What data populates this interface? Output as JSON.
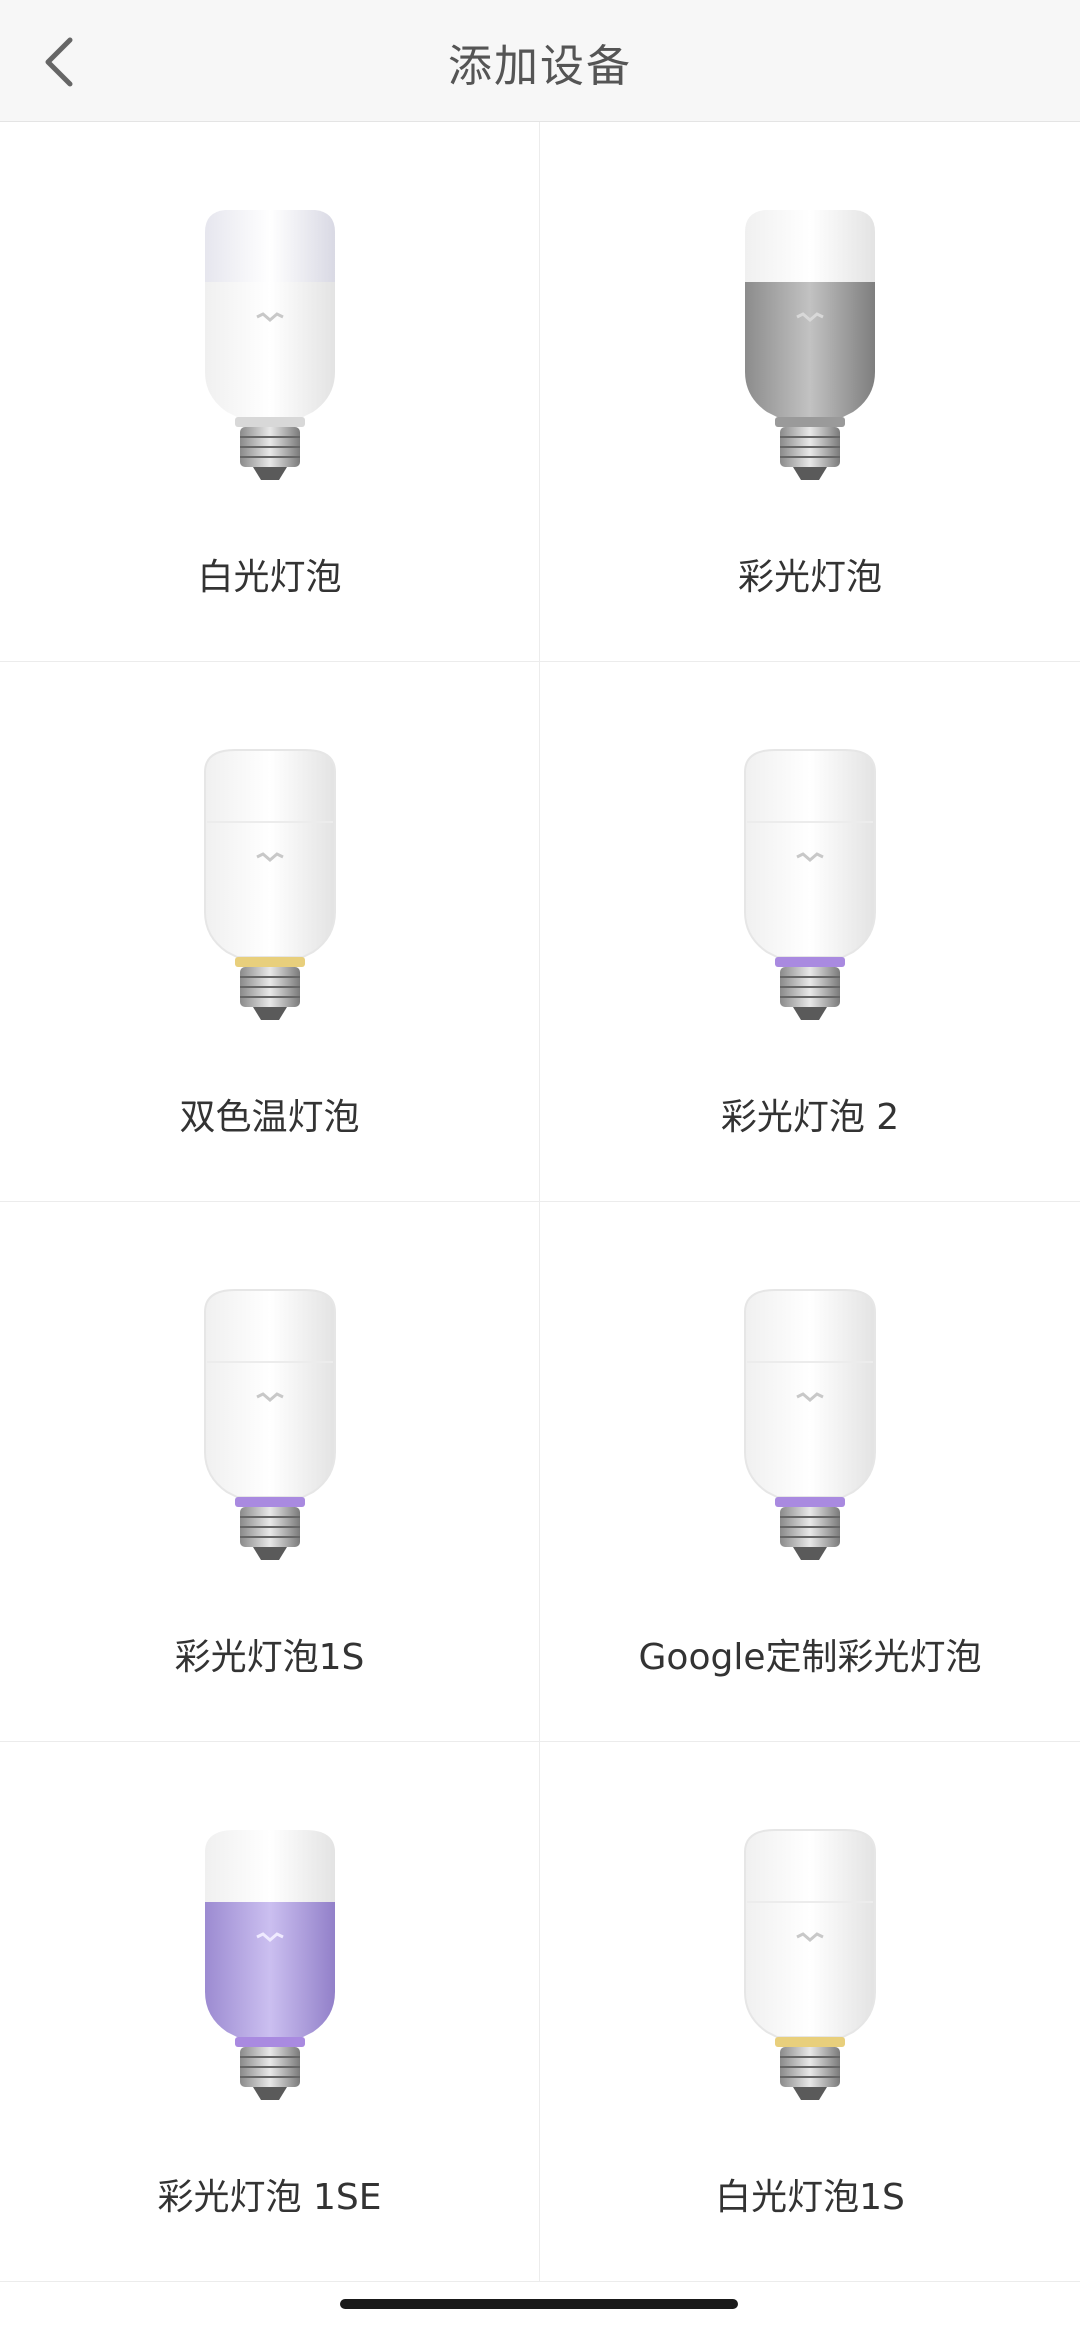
{
  "header": {
    "title": "添加设备",
    "back_icon": "chevron-left-icon"
  },
  "devices": [
    {
      "name": "白光灯泡",
      "style": "white-top-cap",
      "ring": "none"
    },
    {
      "name": "彩光灯泡",
      "style": "gray-band",
      "ring": "none"
    },
    {
      "name": "双色温灯泡",
      "style": "white",
      "ring": "#e8cf7c"
    },
    {
      "name": "彩光灯泡 2",
      "style": "white",
      "ring": "#a98ae0"
    },
    {
      "name": "彩光灯泡1S",
      "style": "white",
      "ring": "#a98ae0"
    },
    {
      "name": "Google定制彩光灯泡",
      "style": "white",
      "ring": "#a98ae0"
    },
    {
      "name": "彩光灯泡 1SE",
      "style": "purple-band",
      "ring": "#a98ae0"
    },
    {
      "name": "白光灯泡1S",
      "style": "white",
      "ring": "#e8cf7c"
    }
  ],
  "colors": {
    "header_bg": "#f7f7f7",
    "divider": "#ececec",
    "gray_band": "#a7a7a7",
    "purple_band": "#b7a6df"
  }
}
